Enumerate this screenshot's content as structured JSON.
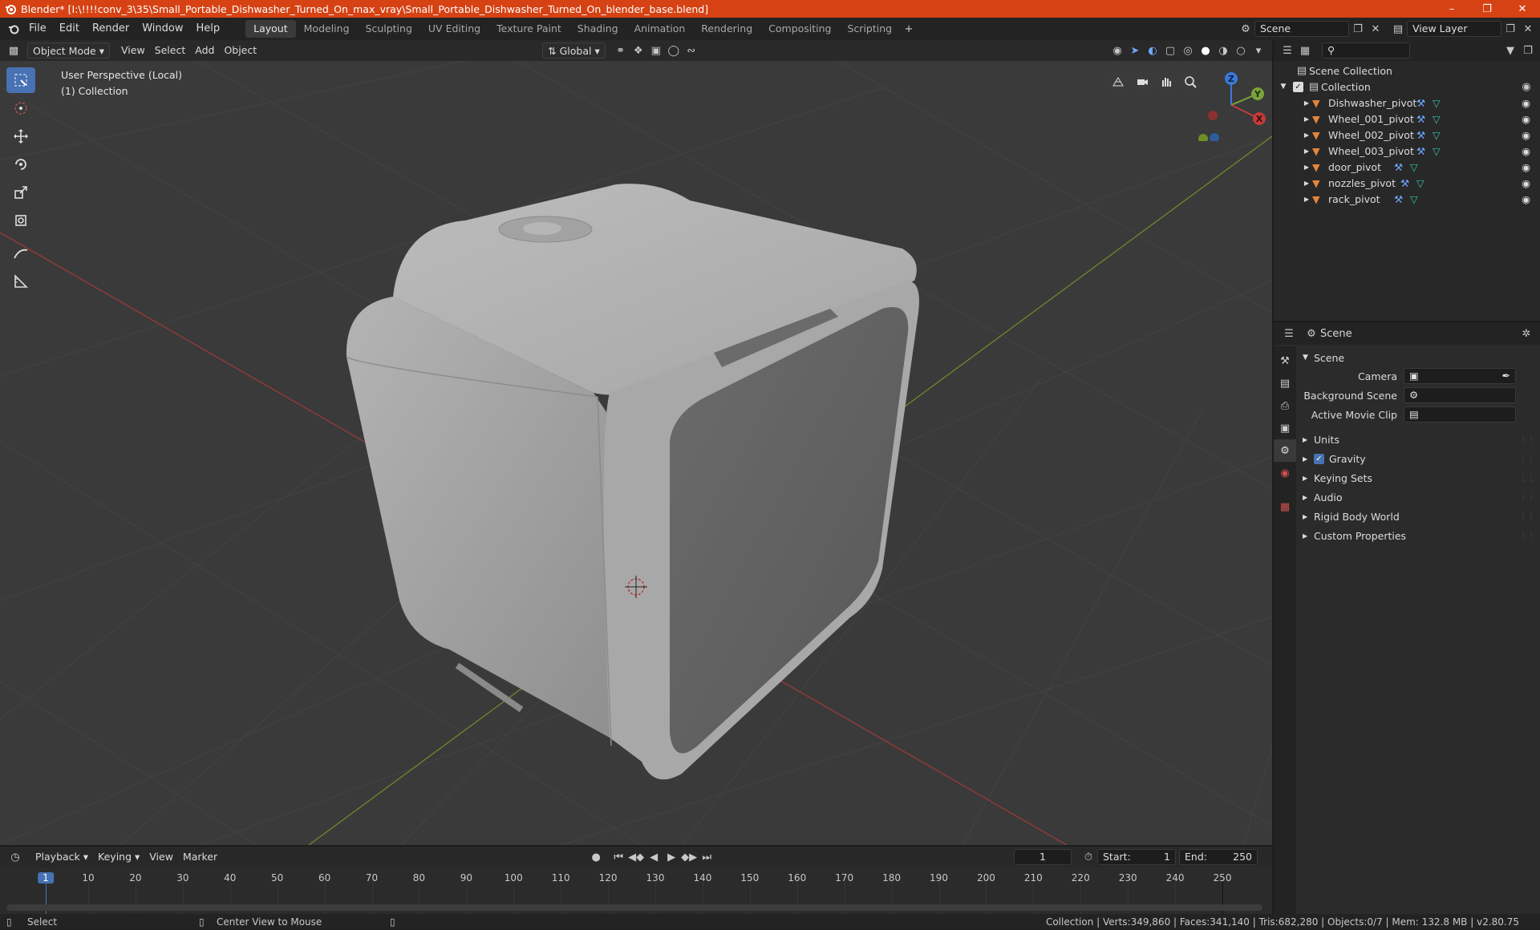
{
  "window": {
    "title": "Blender* [I:\\!!!!conv_3\\35\\Small_Portable_Dishwasher_Turned_On_max_vray\\Small_Portable_Dishwasher_Turned_On_blender_base.blend]"
  },
  "menus": [
    "File",
    "Edit",
    "Render",
    "Window",
    "Help"
  ],
  "workspaces": [
    "Layout",
    "Modeling",
    "Sculpting",
    "UV Editing",
    "Texture Paint",
    "Shading",
    "Animation",
    "Rendering",
    "Compositing",
    "Scripting"
  ],
  "scene_field": "Scene",
  "viewlayer_field": "View Layer",
  "viewport": {
    "mode": "Object Mode",
    "menus": [
      "View",
      "Select",
      "Add",
      "Object"
    ],
    "transform": "Global",
    "perspective": "User Perspective (Local)",
    "collection": "(1) Collection"
  },
  "outliner": {
    "root": "Scene Collection",
    "collection": "Collection",
    "items": [
      "Dishwasher_pivot",
      "Wheel_001_pivot",
      "Wheel_002_pivot",
      "Wheel_003_pivot",
      "door_pivot",
      "nozzles_pivot",
      "rack_pivot"
    ]
  },
  "properties": {
    "breadcrumb": "Scene",
    "panel": "Scene",
    "camera_label": "Camera",
    "bg_scene_label": "Background Scene",
    "movie_clip_label": "Active Movie Clip",
    "sections": [
      "Units",
      "Gravity",
      "Keying Sets",
      "Audio",
      "Rigid Body World",
      "Custom Properties"
    ]
  },
  "timeline": {
    "menus": [
      "Playback",
      "Keying",
      "View",
      "Marker"
    ],
    "current_frame": "1",
    "start_label": "Start:",
    "start": "1",
    "end_label": "End:",
    "end": "250",
    "ticks": [
      "1",
      "10",
      "20",
      "30",
      "40",
      "50",
      "60",
      "70",
      "80",
      "90",
      "100",
      "110",
      "120",
      "130",
      "140",
      "150",
      "160",
      "170",
      "180",
      "190",
      "200",
      "210",
      "220",
      "230",
      "240",
      "250"
    ]
  },
  "status": {
    "select": "Select",
    "center": "Center View to Mouse",
    "stats": "Collection | Verts:349,860 | Faces:341,140 | Tris:682,280 | Objects:0/7 | Mem: 132.8 MB | v2.80.75"
  },
  "colors": {
    "accent": "#4772b3",
    "title_bar": "#d64214",
    "x_axis": "#c33a3a",
    "y_axis": "#7ba33b",
    "object_icon": "#e8843a"
  }
}
